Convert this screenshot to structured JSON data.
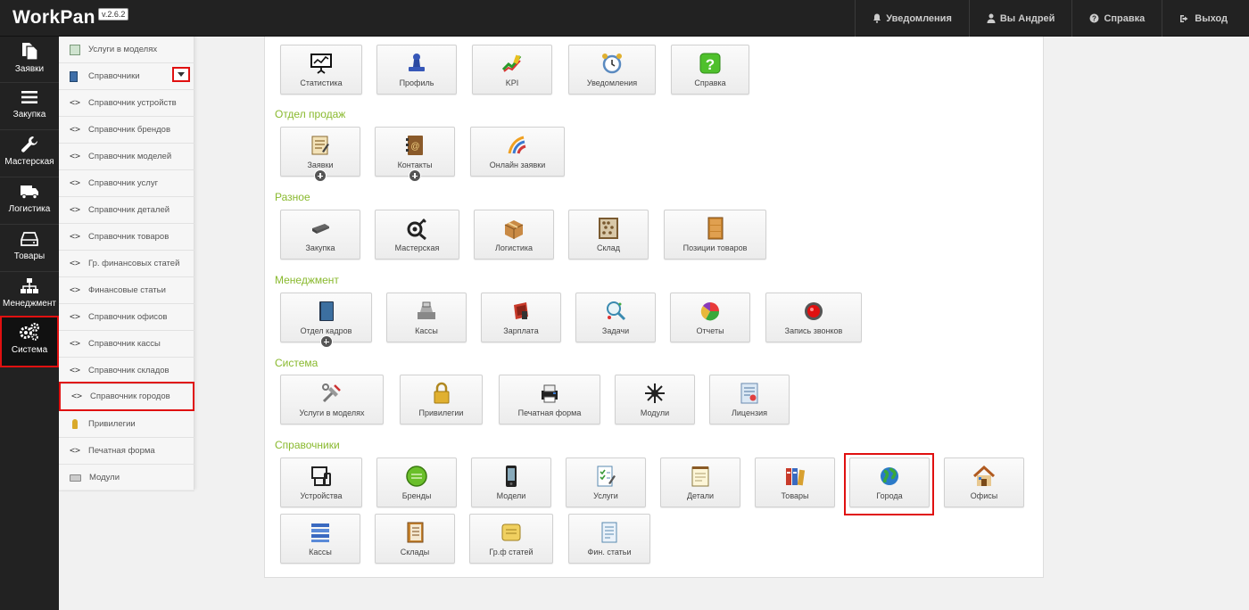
{
  "brand": {
    "name": "WorkPan",
    "version": "v.2.6.2"
  },
  "topnav": [
    {
      "label": "Уведомления",
      "icon": "bell-icon"
    },
    {
      "label": "Вы Андрей",
      "icon": "user-icon"
    },
    {
      "label": "Справка",
      "icon": "question-icon"
    },
    {
      "label": "Выход",
      "icon": "signout-icon"
    }
  ],
  "leftbar": [
    {
      "label": "Заявки",
      "icon": "documents-icon"
    },
    {
      "label": "Закупка",
      "icon": "list-icon"
    },
    {
      "label": "Мастерская",
      "icon": "wrench-icon"
    },
    {
      "label": "Логистика",
      "icon": "truck-icon"
    },
    {
      "label": "Товары",
      "icon": "hdd-icon"
    },
    {
      "label": "Менеджмент",
      "icon": "sitemap-icon"
    },
    {
      "label": "Система",
      "icon": "gears-icon",
      "active": true
    }
  ],
  "submenu": [
    {
      "label": "Услуги в моделях",
      "type": "icon",
      "icon": "notebook-icon"
    },
    {
      "label": "Справочники",
      "type": "icon",
      "icon": "book-icon",
      "dropdown": true
    },
    {
      "label": "Справочник устройств",
      "type": "code"
    },
    {
      "label": "Справочник брендов",
      "type": "code"
    },
    {
      "label": "Справочник моделей",
      "type": "code"
    },
    {
      "label": "Справочник услуг",
      "type": "code"
    },
    {
      "label": "Справочник деталей",
      "type": "code"
    },
    {
      "label": "Справочник товаров",
      "type": "code"
    },
    {
      "label": "Гр. финансовых статей",
      "type": "code"
    },
    {
      "label": "Финансовые статьи",
      "type": "code"
    },
    {
      "label": "Справочник офисов",
      "type": "code"
    },
    {
      "label": "Справочник кассы",
      "type": "code"
    },
    {
      "label": "Справочник складов",
      "type": "code"
    },
    {
      "label": "Справочник городов",
      "type": "code",
      "highlighted": true
    },
    {
      "label": "Привилегии",
      "type": "icon",
      "icon": "key-icon"
    },
    {
      "label": "Печатная форма",
      "type": "code"
    },
    {
      "label": "Модули",
      "type": "icon",
      "icon": "keyboard-icon"
    }
  ],
  "sections": [
    {
      "title": "",
      "tiles": [
        {
          "label": "Статистика",
          "icon": "presentation-icon"
        },
        {
          "label": "Профиль",
          "icon": "stamp-icon"
        },
        {
          "label": "KPI",
          "icon": "chart-icon"
        },
        {
          "label": "Уведомления",
          "icon": "alarm-clock-icon"
        },
        {
          "label": "Справка",
          "icon": "help-icon"
        }
      ]
    },
    {
      "title": "Отдел продаж",
      "tiles": [
        {
          "label": "Заявки",
          "icon": "note-icon",
          "plus": true
        },
        {
          "label": "Контакты",
          "icon": "address-book-icon",
          "plus": true
        },
        {
          "label": "Онлайн заявки",
          "icon": "online-icon"
        }
      ]
    },
    {
      "title": "Разное",
      "tiles": [
        {
          "label": "Закупка",
          "icon": "device-icon"
        },
        {
          "label": "Мастерская",
          "icon": "tools-icon"
        },
        {
          "label": "Логистика",
          "icon": "box-icon"
        },
        {
          "label": "Склад",
          "icon": "abacus-icon"
        },
        {
          "label": "Позиции товаров",
          "icon": "cabinet-icon"
        }
      ]
    },
    {
      "title": "Менеджмент",
      "tiles": [
        {
          "label": "Отдел кадров",
          "icon": "folder-icon",
          "plus": true
        },
        {
          "label": "Кассы",
          "icon": "cash-register-icon"
        },
        {
          "label": "Зарплата",
          "icon": "money-icon"
        },
        {
          "label": "Задачи",
          "icon": "tasks-icon"
        },
        {
          "label": "Отчеты",
          "icon": "pie-icon"
        },
        {
          "label": "Запись звонков",
          "icon": "record-icon"
        }
      ]
    },
    {
      "title": "Система",
      "tiles": [
        {
          "label": "Услуги в моделях",
          "icon": "service-tools-icon"
        },
        {
          "label": "Привилегии",
          "icon": "lock-icon"
        },
        {
          "label": "Печатная форма",
          "icon": "printer-icon"
        },
        {
          "label": "Модули",
          "icon": "modules-icon"
        },
        {
          "label": "Лицензия",
          "icon": "certificate-icon"
        }
      ]
    },
    {
      "title": "Справочники",
      "tiles": [
        {
          "label": "Устройства",
          "icon": "devices-icon"
        },
        {
          "label": "Бренды",
          "icon": "button-green-icon"
        },
        {
          "label": "Модели",
          "icon": "phone-icon"
        },
        {
          "label": "Услуги",
          "icon": "checklist-icon"
        },
        {
          "label": "Детали",
          "icon": "notepad-icon"
        },
        {
          "label": "Товары",
          "icon": "binders-icon"
        },
        {
          "label": "Города",
          "icon": "globe-icon",
          "highlighted": true
        },
        {
          "label": "Офисы",
          "icon": "house-icon"
        },
        {
          "label": "Кассы",
          "icon": "stack-icon"
        },
        {
          "label": "Склады",
          "icon": "ledger-icon"
        },
        {
          "label": "Гр.ф статей",
          "icon": "sticky-folder-icon"
        },
        {
          "label": "Фин. статьи",
          "icon": "paper-icon"
        }
      ]
    }
  ],
  "colors": {
    "topbar": "#222222",
    "section_title": "#89b92e",
    "highlight": "#e01010"
  }
}
